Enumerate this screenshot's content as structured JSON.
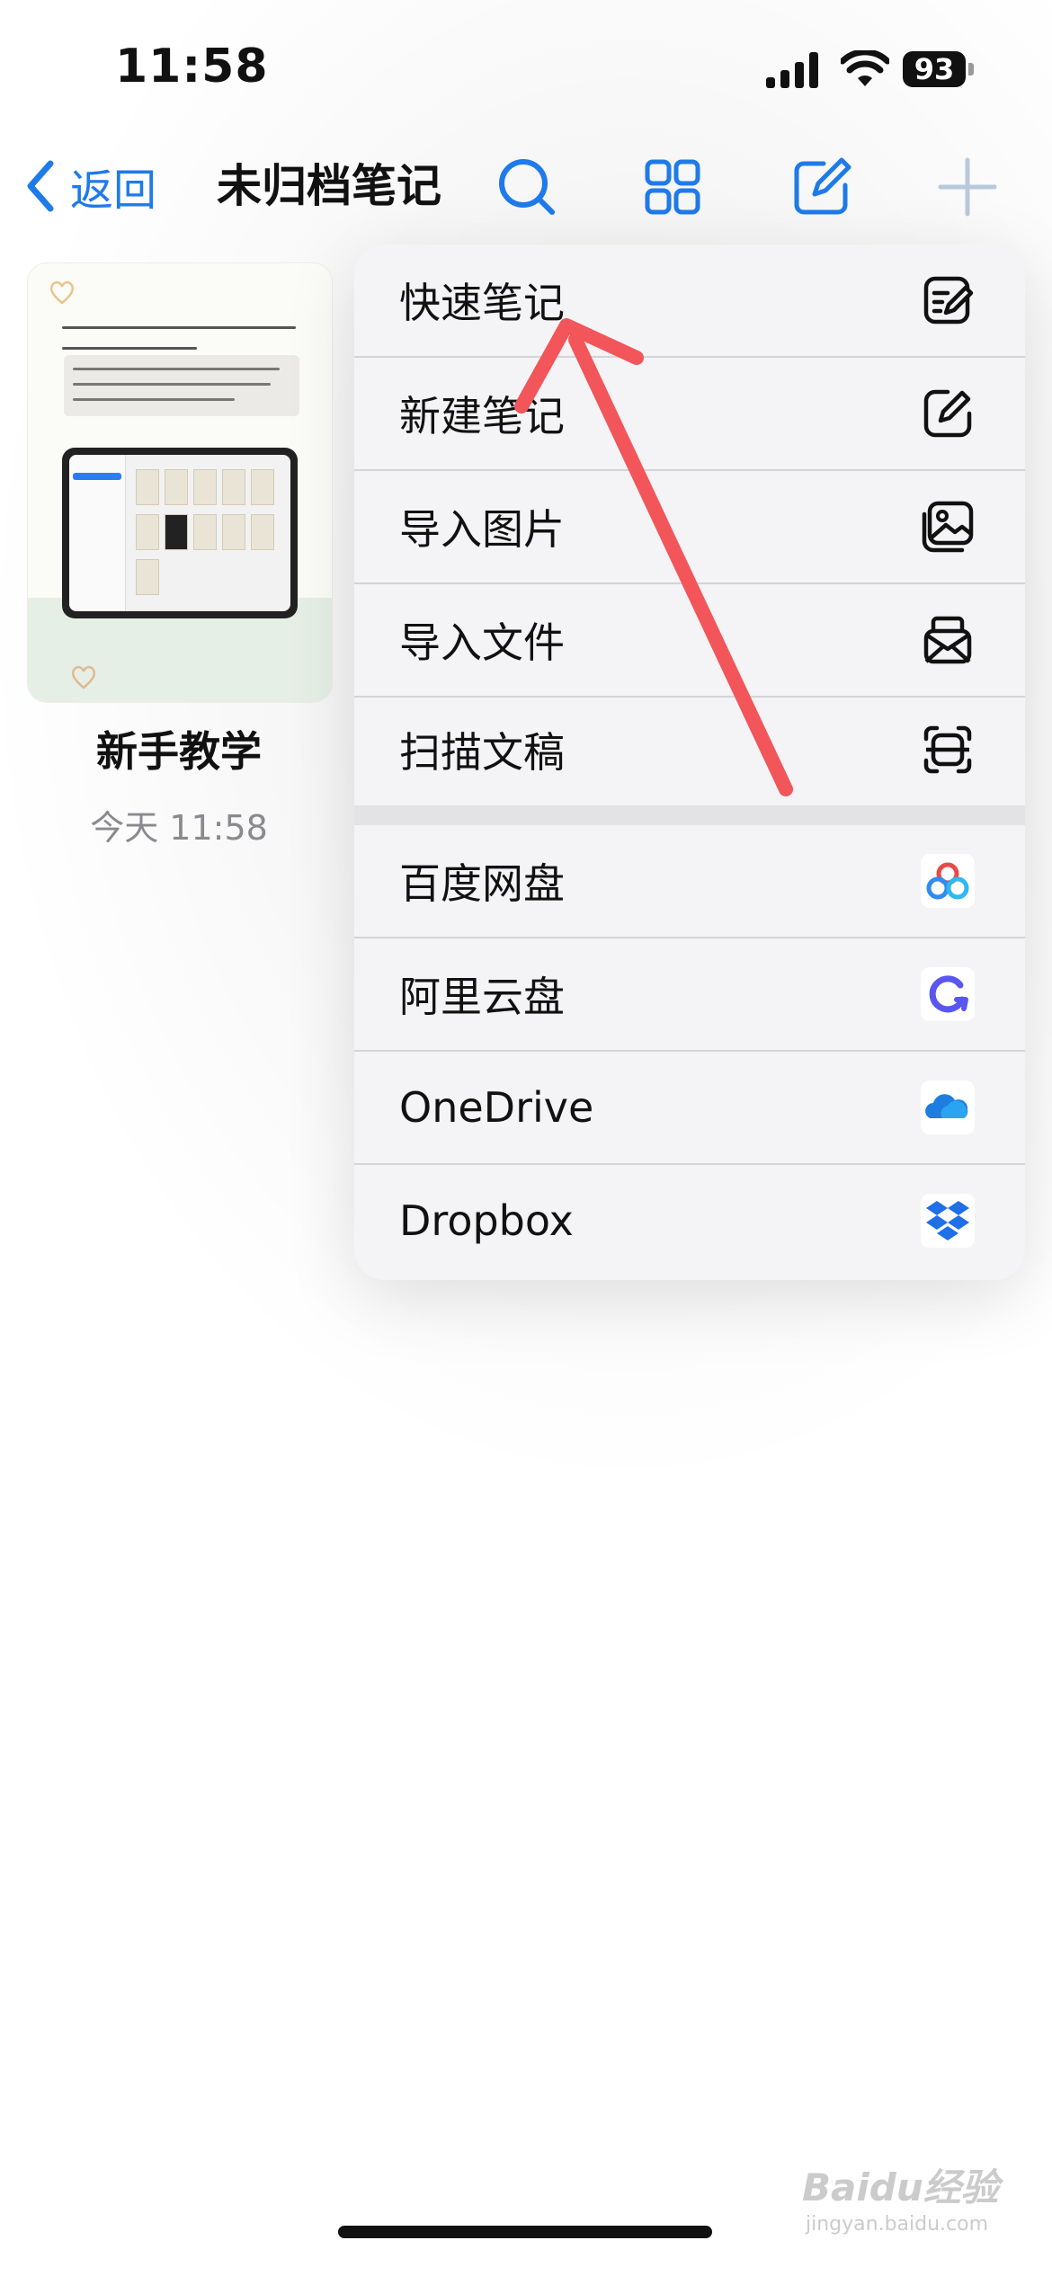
{
  "status_bar": {
    "time": "11:58",
    "battery": "93"
  },
  "nav": {
    "back_label": "返回",
    "title": "未归档笔记",
    "accent_color": "#1f7aea",
    "icons": [
      "chevron-left-icon",
      "search-icon",
      "grid-icon",
      "compose-icon",
      "plus-icon"
    ]
  },
  "note_card": {
    "title": "新手教学",
    "date": "今天 11:58"
  },
  "menu": {
    "primary_items": [
      {
        "label": "快速笔记",
        "icon": "quick-note-icon"
      },
      {
        "label": "新建笔记",
        "icon": "new-note-icon"
      },
      {
        "label": "导入图片",
        "icon": "image-import-icon"
      },
      {
        "label": "导入文件",
        "icon": "file-import-icon"
      },
      {
        "label": "扫描文稿",
        "icon": "scan-icon"
      }
    ],
    "cloud_items": [
      {
        "label": "百度网盘",
        "icon": "baidu-netdisk-icon"
      },
      {
        "label": "阿里云盘",
        "icon": "aliyun-drive-icon"
      },
      {
        "label": "OneDrive",
        "icon": "onedrive-icon"
      },
      {
        "label": "Dropbox",
        "icon": "dropbox-icon"
      }
    ]
  },
  "watermark": {
    "text": "Baidu经验",
    "sub": "jingyan.baidu.com"
  }
}
